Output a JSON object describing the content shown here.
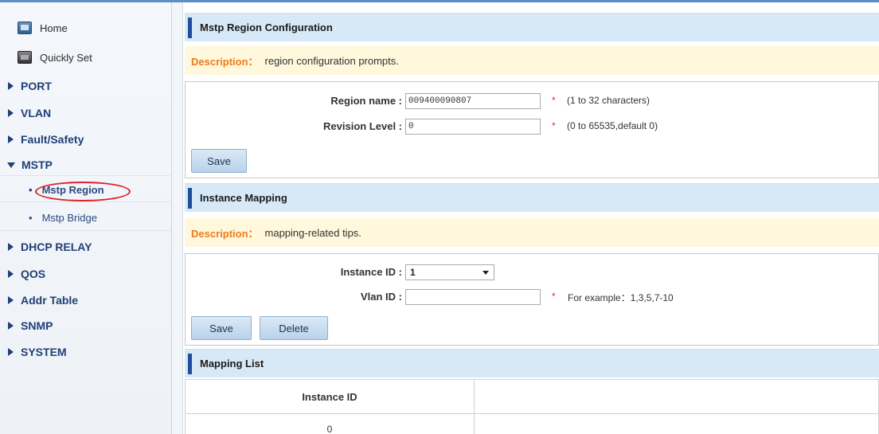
{
  "sidebar": {
    "home": {
      "label": "Home",
      "icon": "home-icon"
    },
    "quick": {
      "label": "Quickly Set",
      "icon": "quick-set-icon"
    },
    "groups": [
      {
        "label": "PORT",
        "expanded": false
      },
      {
        "label": "VLAN",
        "expanded": false
      },
      {
        "label": "Fault/Safety",
        "expanded": false
      },
      {
        "label": "MSTP",
        "expanded": true
      },
      {
        "label": "DHCP RELAY",
        "expanded": false
      },
      {
        "label": "QOS",
        "expanded": false
      },
      {
        "label": "Addr Table",
        "expanded": false
      },
      {
        "label": "SNMP",
        "expanded": false
      },
      {
        "label": "SYSTEM",
        "expanded": false
      }
    ],
    "mstp_items": [
      {
        "label": "Mstp Region",
        "active": true
      },
      {
        "label": "Mstp Bridge",
        "active": false
      }
    ],
    "highlight_color": "#e0202a"
  },
  "region": {
    "title": "Mstp Region Configuration",
    "desc_label": "Description：",
    "desc_text": "region configuration prompts.",
    "region_name_label": "Region name :",
    "region_name_value": "009400090807",
    "region_name_hint": "(1 to 32 characters)",
    "revision_label": "Revision Level :",
    "revision_value": "0",
    "revision_hint": "(0 to 65535,default 0)",
    "required_mark": "*",
    "save_label": "Save"
  },
  "mapping": {
    "title": "Instance Mapping",
    "desc_label": "Description：",
    "desc_text": "mapping-related tips.",
    "instance_label": "Instance ID :",
    "instance_value": "1",
    "vlan_label": "Vlan ID :",
    "vlan_value": "",
    "vlan_hint": "For example：1,3,5,7-10",
    "required_mark": "*",
    "save_label": "Save",
    "delete_label": "Delete"
  },
  "list": {
    "title": "Mapping List",
    "columns": [
      "Instance ID",
      ""
    ],
    "rows": [
      [
        "0",
        ""
      ]
    ]
  },
  "colors": {
    "accent": "#1f4f9b",
    "header_bg": "#d7e9f6",
    "desc_bg": "#fff8dc",
    "desc_label": "#f07a1a"
  }
}
